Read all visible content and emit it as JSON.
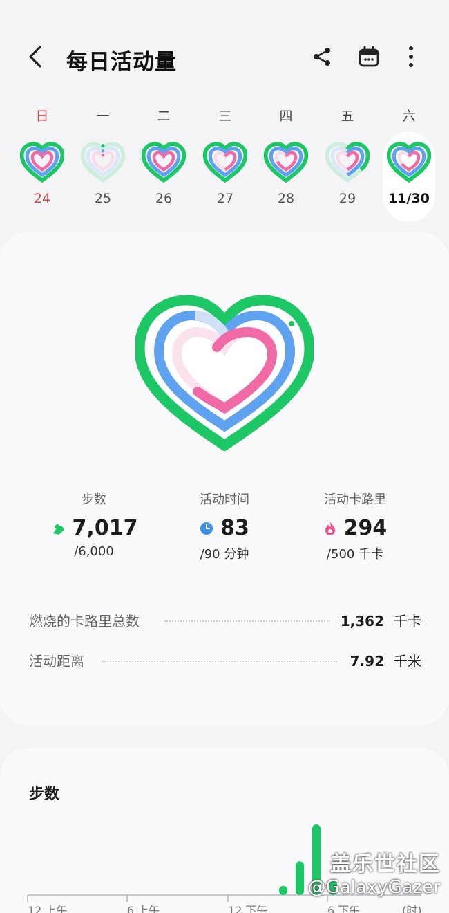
{
  "header": {
    "title": "每日活动量",
    "back_icon": "chevron-left-icon",
    "share_icon": "share-icon",
    "calendar_icon": "calendar-icon",
    "more_icon": "more-vertical-icon"
  },
  "week": [
    {
      "weekday": "日",
      "date": "24",
      "selected": false
    },
    {
      "weekday": "一",
      "date": "25",
      "selected": false
    },
    {
      "weekday": "二",
      "date": "26",
      "selected": false
    },
    {
      "weekday": "三",
      "date": "27",
      "selected": false
    },
    {
      "weekday": "四",
      "date": "28",
      "selected": false
    },
    {
      "weekday": "五",
      "date": "29",
      "selected": false
    },
    {
      "weekday": "六",
      "date": "11/30",
      "selected": true
    }
  ],
  "metrics": {
    "steps": {
      "label": "步数",
      "value": "7,017",
      "goal": "/6,000",
      "icon": "shoe-icon",
      "color": "#1ec765"
    },
    "active_time": {
      "label": "活动时间",
      "value": "83",
      "goal": "/90 分钟",
      "icon": "clock-icon",
      "color": "#3d8fe8"
    },
    "active_calories": {
      "label": "活动卡路里",
      "value": "294",
      "goal": "/500 千卡",
      "icon": "flame-icon",
      "color": "#ef4f8f"
    }
  },
  "totals": {
    "calories": {
      "label": "燃烧的卡路里总数",
      "value": "1,362",
      "unit": "千卡"
    },
    "distance": {
      "label": "活动距离",
      "value": "7.92",
      "unit": "千米"
    }
  },
  "steps_chart": {
    "title": "步数",
    "x_labels": [
      "12 上午",
      "6 上午",
      "12 下午",
      "6 下午",
      "(时)"
    ]
  },
  "chart_data": {
    "type": "bar",
    "title": "步数",
    "x": [
      15,
      16,
      17,
      18
    ],
    "values": [
      300,
      1100,
      2300,
      500
    ],
    "xlabel": "(时)",
    "x_ticks": [
      "12 上午",
      "6 上午",
      "12 下午",
      "6 下午"
    ],
    "color": "#1ec765"
  },
  "watermark": {
    "line1": "盖乐世社区",
    "line2": "@GalaxyGazer"
  },
  "colors": {
    "green": "#1ec765",
    "blue": "#5fa3f0",
    "pink": "#f06aa6",
    "sunday": "#c84a4a"
  }
}
